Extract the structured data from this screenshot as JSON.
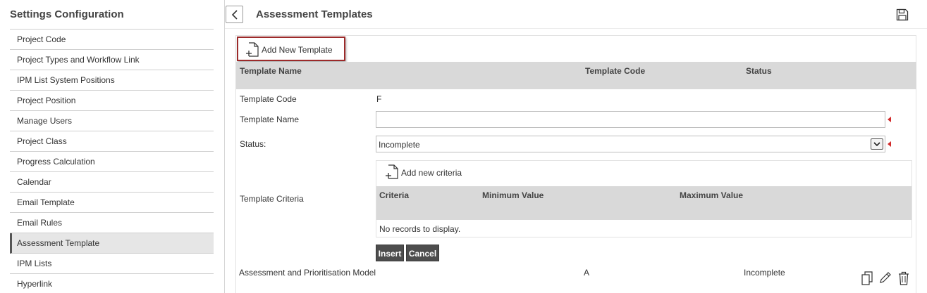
{
  "sidebar": {
    "title": "Settings Configuration",
    "items": [
      {
        "label": "Project Code"
      },
      {
        "label": "Project Types and Workflow Link"
      },
      {
        "label": "IPM List System Positions"
      },
      {
        "label": "Project Position"
      },
      {
        "label": "Manage Users"
      },
      {
        "label": "Project Class"
      },
      {
        "label": "Progress Calculation"
      },
      {
        "label": "Calendar"
      },
      {
        "label": "Email Template"
      },
      {
        "label": "Email Rules"
      },
      {
        "label": "Assessment Template",
        "active": true
      },
      {
        "label": "IPM Lists"
      },
      {
        "label": "Hyperlink"
      }
    ]
  },
  "header": {
    "title": "Assessment Templates",
    "back_icon": "chevron-left-icon",
    "save_icon": "save-icon"
  },
  "toolbar": {
    "add_template_label": "Add New Template",
    "add_template_icon": "add-document-icon"
  },
  "grid": {
    "columns": [
      "Template Name",
      "Template Code",
      "Status"
    ],
    "rows": [
      {
        "name": "Assessment and Prioritisation Model",
        "code": "A",
        "status": "Incomplete"
      }
    ]
  },
  "form": {
    "code_label": "Template Code",
    "code_value": "F",
    "name_label": "Template Name",
    "name_value": "",
    "status_label": "Status:",
    "status_value": "Incomplete",
    "criteria_label": "Template Criteria",
    "add_criteria_label": "Add new criteria",
    "criteria_columns": [
      "Criteria",
      "Minimum Value",
      "Maximum Value"
    ],
    "no_records": "No records to display.",
    "insert_label": "Insert",
    "cancel_label": "Cancel"
  },
  "colors": {
    "highlight_border": "#9c2a2a",
    "required_marker": "#d12a2a",
    "grid_header_bg": "#d9d9d9",
    "button_bg": "#4d4d4d"
  },
  "row_actions": [
    "copy-icon",
    "edit-icon",
    "delete-icon"
  ]
}
